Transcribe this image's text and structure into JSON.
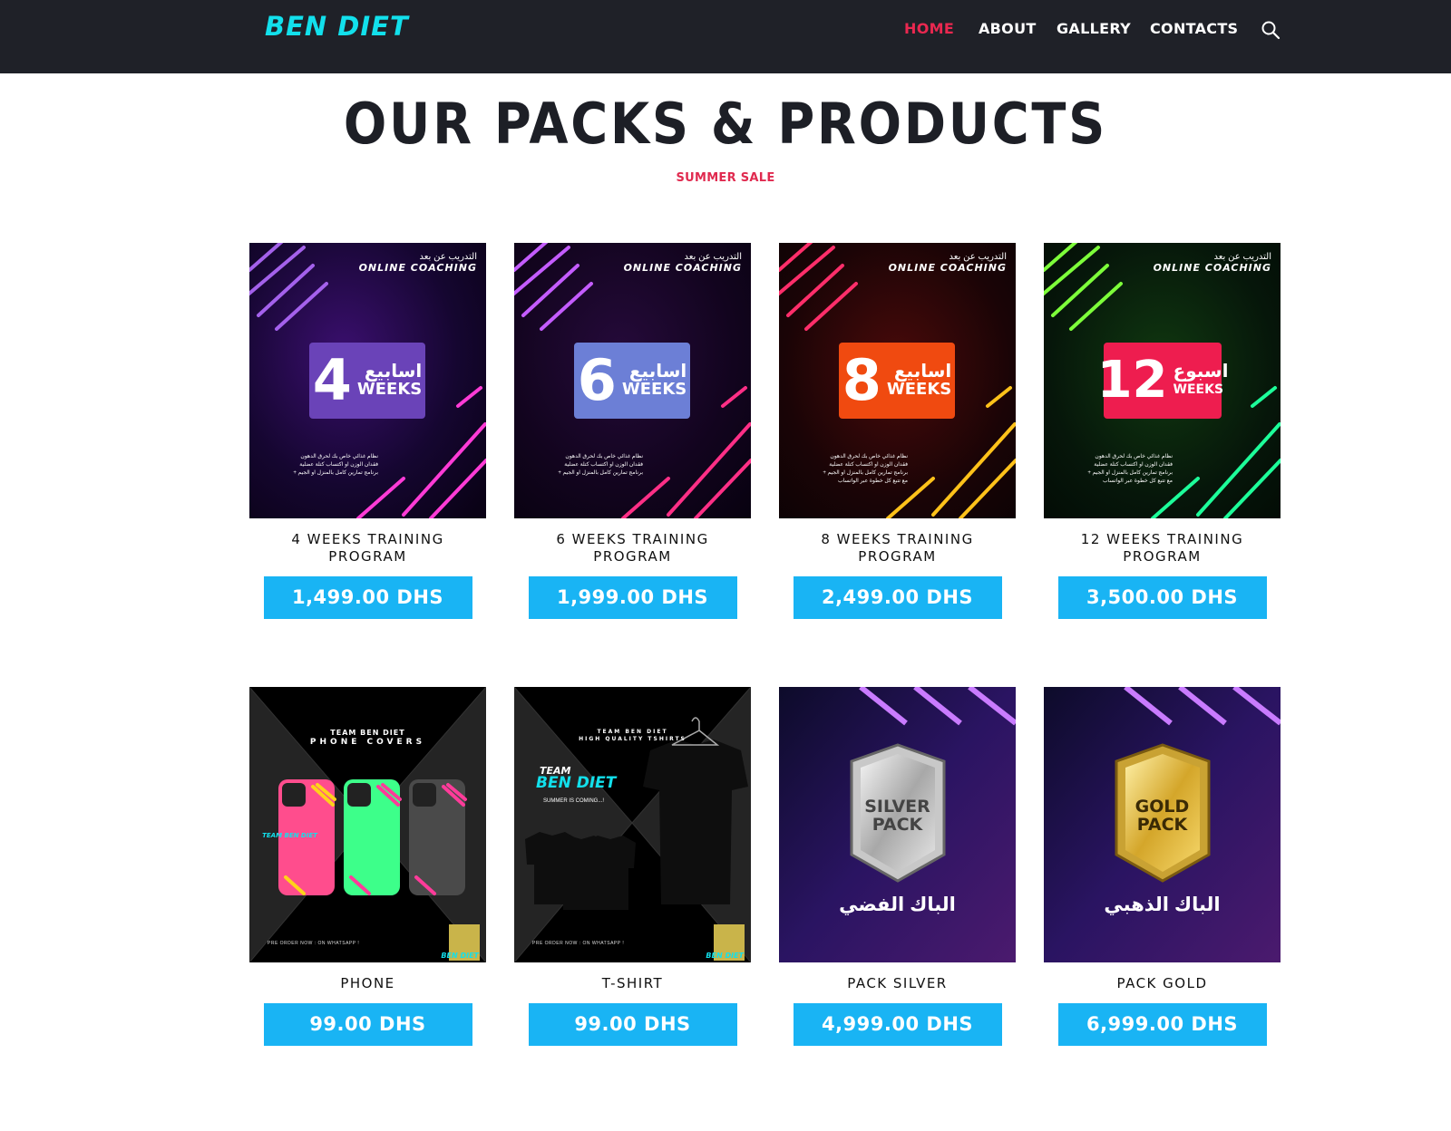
{
  "header": {
    "logo": "BEN DIET",
    "nav": [
      {
        "label": "HOME",
        "active": true
      },
      {
        "label": "ABOUT",
        "active": false
      },
      {
        "label": "GALLERY",
        "active": false
      },
      {
        "label": "CONTACTS",
        "active": false
      }
    ],
    "search_icon": "search-icon"
  },
  "main": {
    "title": "OUR PACKS & PRODUCTS",
    "subtitle": "SUMMER SALE"
  },
  "coaching_common": {
    "arabic_title": "التدريب عن بعد",
    "english_title": "ONLINE COACHING",
    "desc_line1": "نظام غذائي خاص بك لحرق الدهون",
    "desc_line2": "فقدان الوزن او اكتساب كتلة عضلية",
    "desc_line3": "+ برنامج تمارين كامل بالمنزل او الجيم",
    "desc_line4": "مع تتبع كل خطوة عبر الواتساب"
  },
  "products": [
    {
      "name": "4 WEEKS TRAINING PROGRAM",
      "price": "1,499.00 DHS",
      "badge_num": "4",
      "badge_ar": "اسابيع",
      "badge_en": "WEEKS",
      "badge_color": "#6a43b8"
    },
    {
      "name": "6 WEEKS TRAINING PROGRAM",
      "price": "1,999.00 DHS",
      "badge_num": "6",
      "badge_ar": "اسابيع",
      "badge_en": "WEEKS",
      "badge_color": "#6c7fd6"
    },
    {
      "name": "8 WEEKS TRAINING PROGRAM",
      "price": "2,499.00 DHS",
      "badge_num": "8",
      "badge_ar": "اسابيع",
      "badge_en": "WEEKS",
      "badge_color": "#f04a10"
    },
    {
      "name": "12 WEEKS TRAINING PROGRAM",
      "price": "3,500.00 DHS",
      "badge_num": "12",
      "badge_ar": "اسبوع",
      "badge_en": "WEEKS",
      "badge_color": "#ee1d4f"
    },
    {
      "name": "PHONE",
      "price": "99.00 DHS",
      "line1": "TEAM BEN DIET",
      "line2": "PHONE COVERS",
      "footer": "PRE ORDER NOW : ON WHATSAPP !",
      "tag": "BEN DIET",
      "case_brand": "TEAM BEN DIET"
    },
    {
      "name": "T-SHIRT",
      "price": "99.00 DHS",
      "line1": "TEAM BEN DIET",
      "line2": "HIGH QUALITY TSHIRTS",
      "footer": "PRE ORDER NOW : ON WHATSAPP !",
      "tag": "BEN DIET",
      "brand_team": "TEAM",
      "brand_name": "BEN DIET",
      "brand_tagline": "SUMMER IS COMING...!"
    },
    {
      "name": "PACK SILVER",
      "price": "4,999.00 DHS",
      "shield_l1": "SILVER",
      "shield_l2": "PACK",
      "arabic": "الباك الفضي"
    },
    {
      "name": "PACK GOLD",
      "price": "6,999.00 DHS",
      "shield_l1": "GOLD",
      "shield_l2": "PACK",
      "arabic": "الباك الذهبي"
    }
  ],
  "colors": {
    "header_bg": "#1f2128",
    "logo": "#12e0ec",
    "nav_active": "#ea2850",
    "price_button": "#19b4f4",
    "subtitle": "#e02a4f"
  }
}
